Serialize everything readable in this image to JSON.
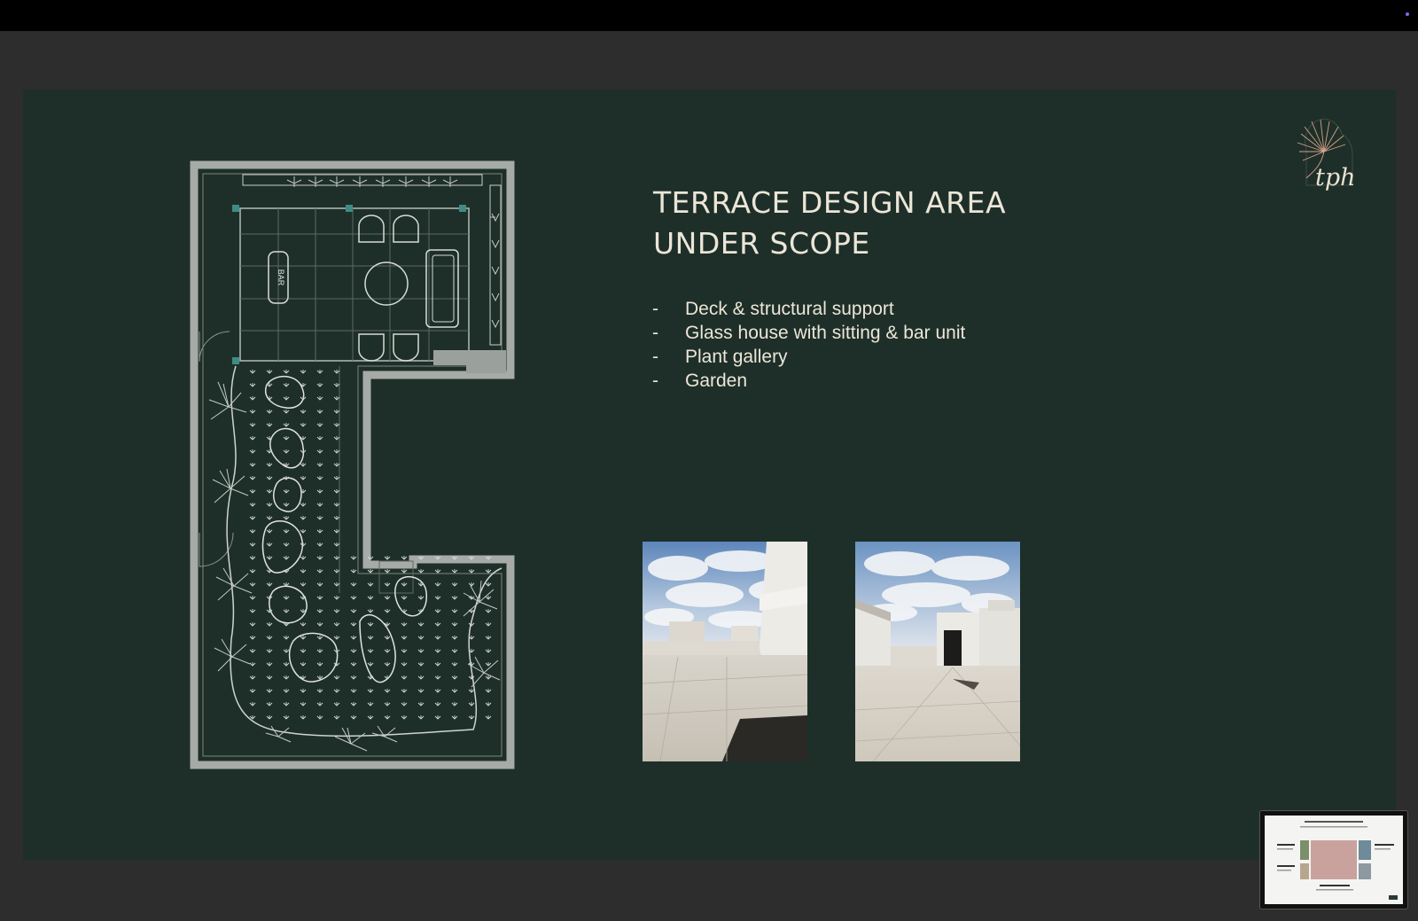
{
  "slide": {
    "title_line1": "TERRACE DESIGN AREA",
    "title_line2": "UNDER SCOPE",
    "bullets": [
      "Deck & structural support",
      "Glass house with sitting & bar unit",
      "Plant gallery",
      "Garden"
    ],
    "bullet_marker": "-",
    "plan_label": "BAR",
    "logo_text": "tph"
  },
  "colors": {
    "slide_bg": "#1e2f29",
    "text": "#ece6d8",
    "accent": "#d6a28a"
  },
  "icons": {
    "logo": "palm-leaf-logo-icon",
    "thumbnail": "next-slide-thumbnail"
  }
}
